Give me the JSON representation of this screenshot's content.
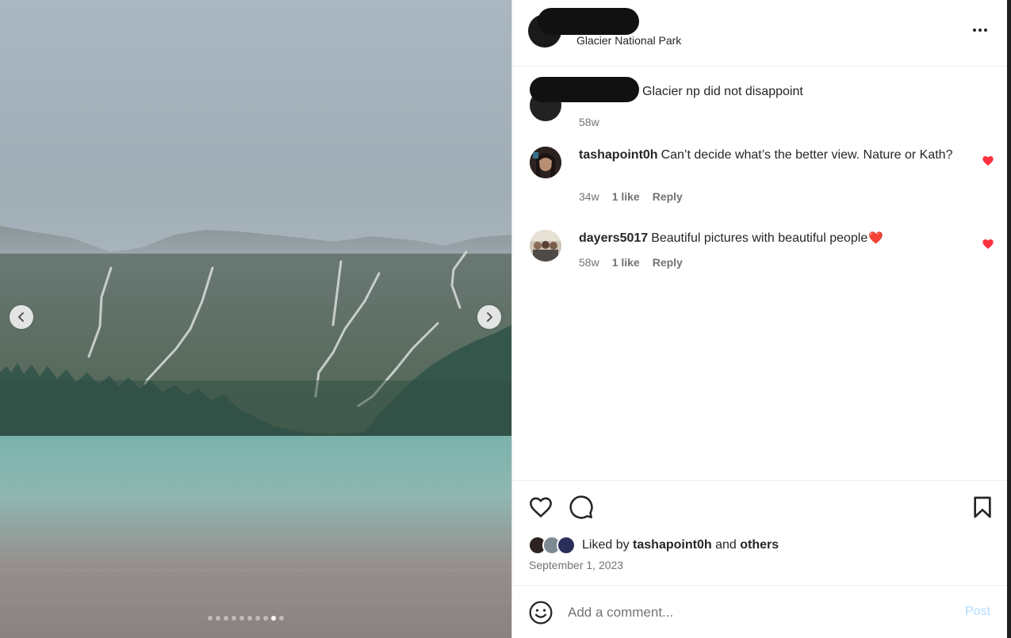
{
  "post": {
    "location": "Glacier National Park",
    "more_icon": "more-options-icon"
  },
  "media": {
    "prev_icon": "chevron-left-icon",
    "next_icon": "chevron-right-icon",
    "total_slides": 10,
    "active_slide": 9
  },
  "caption": {
    "text": "Glacier np did not disappoint",
    "time": "58w"
  },
  "comments": [
    {
      "username": "tashapoint0h",
      "text": "Can’t decide what’s the better view. Nature or Kath?",
      "time": "34w",
      "likes": "1 like",
      "reply": "Reply",
      "liked": true
    },
    {
      "username": "dayers5017",
      "text": "Beautiful pictures with beautiful people",
      "emoji": "❤️",
      "time": "58w",
      "likes": "1 like",
      "reply": "Reply",
      "liked": true
    }
  ],
  "actions": {
    "like_icon": "heart-outline-icon",
    "comment_icon": "comment-icon",
    "save_icon": "bookmark-icon"
  },
  "likes_summary": {
    "prefix": "Liked by",
    "user": "tashapoint0h",
    "conjunction": "and",
    "others": "others"
  },
  "date": "September 1, 2023",
  "composer": {
    "placeholder": "Add a comment...",
    "post_label": "Post",
    "emoji_icon": "smiley-icon"
  },
  "colors": {
    "heart": "#ff3040",
    "post_disabled": "#b3dbff",
    "meta_text": "#737373"
  }
}
